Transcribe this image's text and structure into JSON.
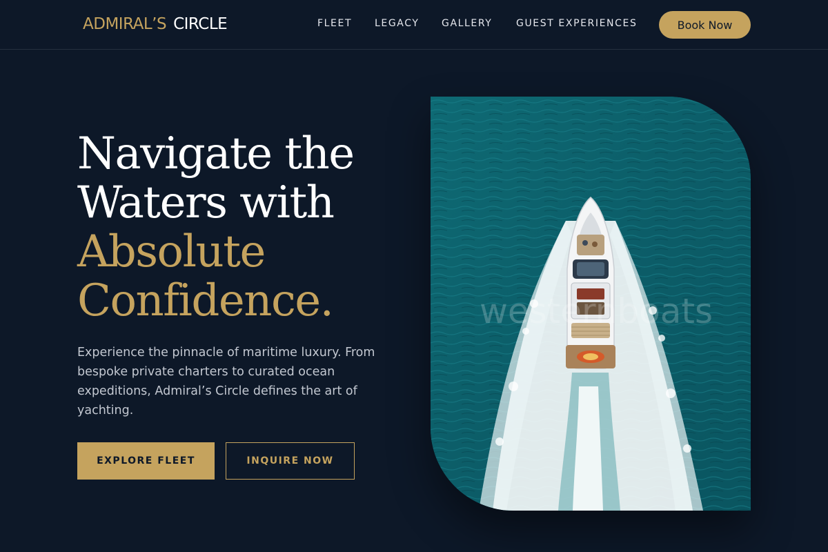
{
  "brand": {
    "part1": "ADMIRAL’S",
    "part2": "CIRCLE",
    "gold": "#c5a35e"
  },
  "nav": {
    "items": [
      {
        "label": "FLEET"
      },
      {
        "label": "LEGACY"
      },
      {
        "label": "GALLERY"
      },
      {
        "label": "GUEST EXPERIENCES"
      }
    ],
    "cta_label": "Book Now"
  },
  "hero": {
    "headline_line1": "Navigate the",
    "headline_line2": "Waters with",
    "headline_line3": "Absolute",
    "headline_line4": "Confidence.",
    "lead": "Experience the pinnacle of maritime luxury. From bespoke private charters to curated ocean expeditions, Admiral’s Circle defines the art of yachting.",
    "primary_button": "EXPLORE FLEET",
    "secondary_button": "INQUIRE NOW",
    "image_watermark": "westernboats"
  },
  "colors": {
    "background": "#0d1828",
    "accent": "#c5a35e",
    "text": "#ffffff",
    "muted_text": "#c3c8d1",
    "sea": "#0f6670"
  }
}
